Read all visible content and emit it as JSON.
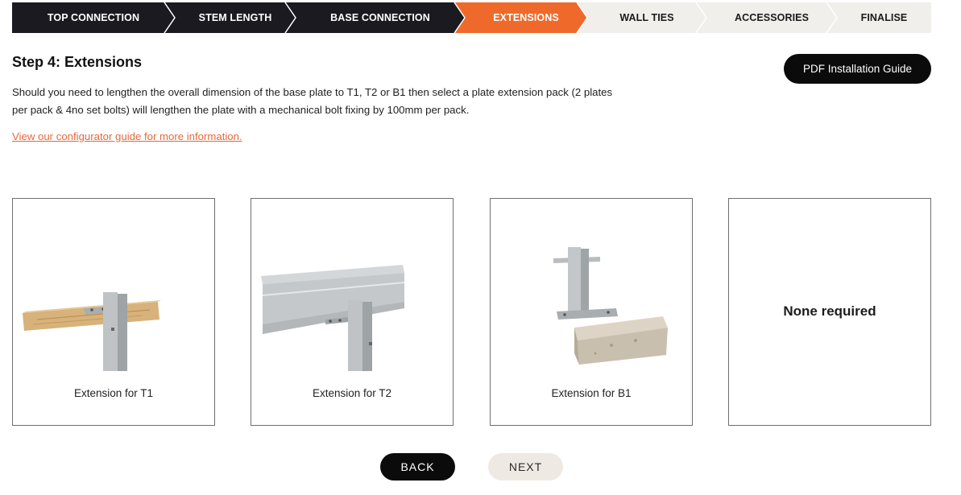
{
  "stepper": {
    "colors": {
      "done": "#1a1a20",
      "active": "#ef6a2a",
      "todo": "#f1efec",
      "done_text": "#ffffff",
      "todo_text": "#1a1a1a"
    },
    "steps": [
      {
        "label": "TOP CONNECTION",
        "state": "done"
      },
      {
        "label": "STEM LENGTH",
        "state": "done"
      },
      {
        "label": "BASE CONNECTION",
        "state": "done"
      },
      {
        "label": "EXTENSIONS",
        "state": "active"
      },
      {
        "label": "WALL TIES",
        "state": "todo"
      },
      {
        "label": "ACCESSORIES",
        "state": "todo"
      },
      {
        "label": "FINALISE",
        "state": "todo"
      }
    ]
  },
  "page": {
    "title": "Step 4: Extensions",
    "intro_line1": "Should you need to lengthen the overall dimension of the base plate to T1, T2 or B1 then select a plate extension pack (2 plates",
    "intro_line2": "per pack & 4no set bolts) will lengthen the plate with a mechanical bolt fixing by 100mm per pack.",
    "guide_link": "View our configurator guide for more information.",
    "pdf_button": "PDF Installation Guide"
  },
  "options": [
    {
      "label": "Extension for T1",
      "icon": "timber-beam-extension-icon"
    },
    {
      "label": "Extension for T2",
      "icon": "steel-beam-extension-icon"
    },
    {
      "label": "Extension for B1",
      "icon": "block-extension-icon"
    },
    {
      "label": "None required"
    }
  ],
  "nav": {
    "back": "BACK",
    "next": "NEXT"
  }
}
